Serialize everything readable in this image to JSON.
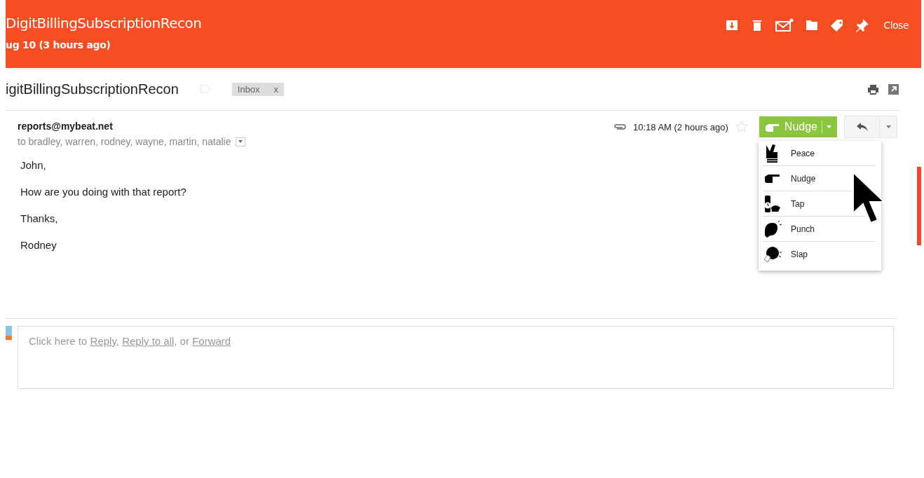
{
  "header": {
    "title": "DigitBillingSubscriptionRecon",
    "subtitle": "ug 10 (3 hours ago)",
    "actions": [
      {
        "kind": "archive"
      },
      {
        "kind": "trash"
      },
      {
        "kind": "mail"
      },
      {
        "kind": "folder"
      },
      {
        "kind": "tag"
      },
      {
        "kind": "pin"
      }
    ],
    "close": "Close"
  },
  "subject": {
    "text": "igitBillingSubscriptionRecon",
    "label": "Inbox",
    "label_remove": "x"
  },
  "message": {
    "sender": "reports@mybeat.net",
    "recipients": "to bradley, warren, rodney, wayne, martin, natalie",
    "time": "10:18 AM (2 hours ago)",
    "starred": false,
    "nudge_label": "Nudge",
    "body": [
      "John,",
      "How are you doing with that report?",
      "Thanks,",
      "Rodney"
    ]
  },
  "nudge_menu": [
    {
      "kind": "peace",
      "label": "Peace"
    },
    {
      "kind": "nudge",
      "label": "Nudge"
    },
    {
      "kind": "tap",
      "label": "Tap"
    },
    {
      "kind": "punch",
      "label": "Punch"
    },
    {
      "kind": "slap",
      "label": "Slap"
    }
  ],
  "reply_prompt": [
    {
      "kind": "text",
      "text": "Click here to "
    },
    {
      "kind": "link",
      "text": "Reply"
    },
    {
      "kind": "text",
      "text": ", "
    },
    {
      "kind": "link",
      "text": "Reply to all"
    },
    {
      "kind": "text",
      "text": ", or "
    },
    {
      "kind": "link",
      "text": "Forward"
    }
  ]
}
